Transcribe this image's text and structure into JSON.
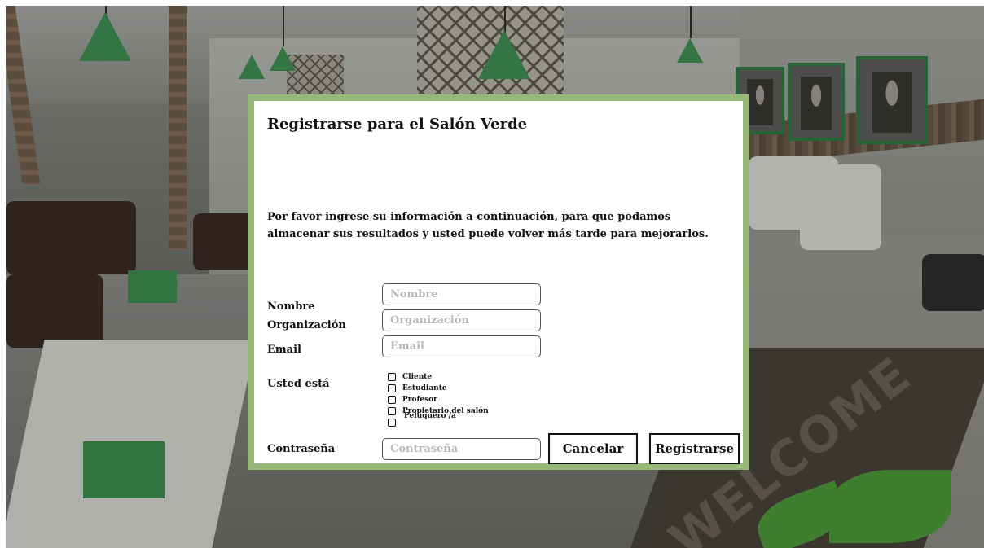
{
  "dialog": {
    "title": "Registrarse para el Salón Verde",
    "intro": "Por favor ingrese su información a continuación, para que podamos almacenar sus resultados y usted puede volver más tarde para mejorarlos."
  },
  "form": {
    "name_label": "Nombre",
    "name_placeholder": "Nombre",
    "name_value": "",
    "org_label": "Organización",
    "org_placeholder": "Organización",
    "org_value": "",
    "email_label": "Email",
    "email_placeholder": "Email",
    "email_value": "",
    "role_label": "Usted está",
    "roles": [
      {
        "label": "Cliente",
        "checked": false
      },
      {
        "label": "Estudiante",
        "checked": false
      },
      {
        "label": "Profesor",
        "checked": false
      },
      {
        "label": "Propietario del salón",
        "checked": false
      },
      {
        "label": "Peluquero /a",
        "checked": false
      }
    ],
    "password_label": "Contraseña",
    "password_placeholder": "Contraseña",
    "password_value": ""
  },
  "buttons": {
    "cancel": "Cancelar",
    "register": "Registrarse"
  },
  "colors": {
    "dialog_border": "#96b97a",
    "accent_green": "#3f8f52"
  },
  "background": {
    "mat_text": "WELCOME"
  }
}
